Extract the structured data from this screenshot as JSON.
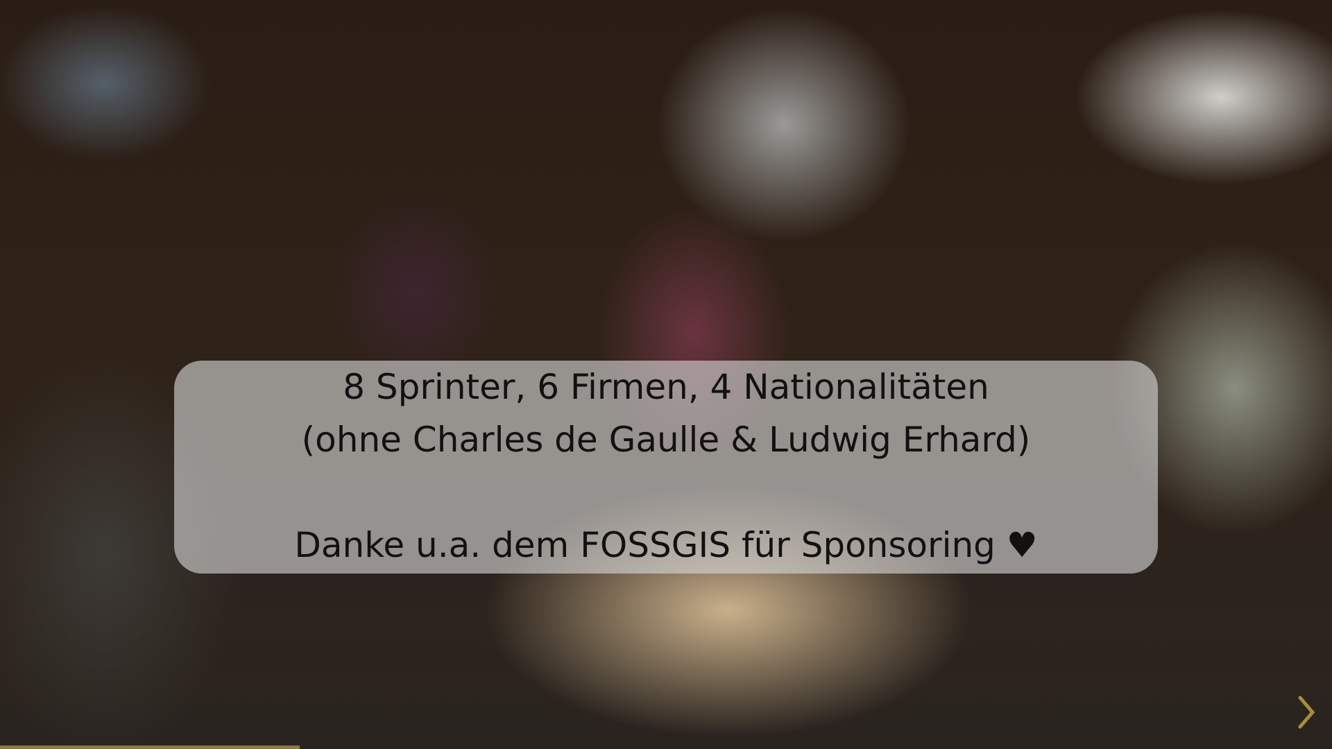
{
  "slide": {
    "lines": [
      "8 Sprinter, 6 Firmen, 4 Nationalitäten",
      "(ohne Charles de Gaulle & Ludwig Erhard)",
      "Danke u.a. dem FOSSGIS für Sponsoring ♥"
    ]
  },
  "navigation": {
    "next_icon": "chevron-right-icon"
  },
  "progress": {
    "fraction": 0.225,
    "color": "#8c7c3e"
  }
}
